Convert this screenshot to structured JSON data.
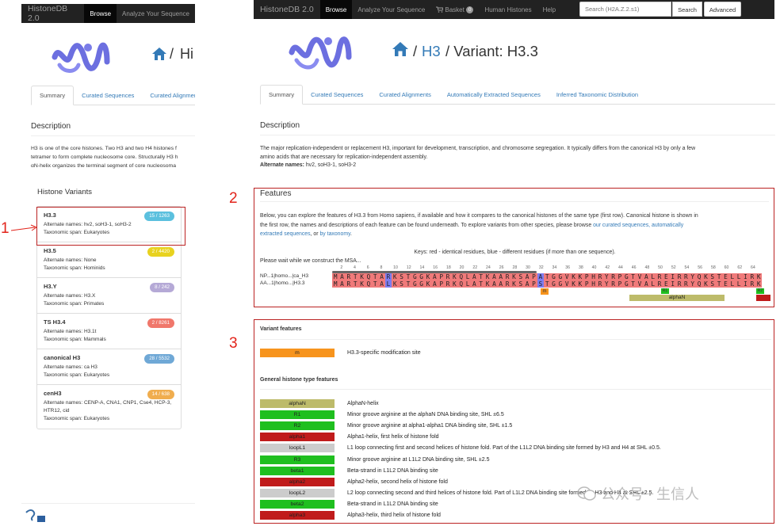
{
  "left": {
    "nav": {
      "brand": "HistoneDB 2.0",
      "browse": "Browse",
      "analyze": "Analyze Your Sequence"
    },
    "title": {
      "slash": "/",
      "text": "Hi"
    },
    "tabs": [
      "Summary",
      "Curated Sequences",
      "Curated Alignmen"
    ],
    "desc_heading": "Description",
    "desc_lines": [
      "H3 is one of the core histones. Two H3 and two H4 histones f",
      "tetramer to form complete nucleosome core. Structurally H3 h",
      "αN-helix organizes the terminal segment of core nucleosoma"
    ],
    "variants_heading": "Histone Variants",
    "variants": [
      {
        "name": "H3.3",
        "badge": "15 / 1263",
        "badge_color": "#5bc0de",
        "line1": "Alternate names: hv2, soH3-1, soH3-2",
        "line2": "Taxonomic span: Eukaryotes"
      },
      {
        "name": "H3.5",
        "badge": "2 / 4420",
        "badge_color": "#e8d21f",
        "line1": "Alternate names: None",
        "line2": "Taxonomic span: Hominids"
      },
      {
        "name": "H3.Y",
        "badge": "8 / 242",
        "badge_color": "#b5a9d6",
        "line1": "Alternate names: H3.X",
        "line2": "Taxonomic span: Primates"
      },
      {
        "name": "TS H3.4",
        "badge": "2 / 8261",
        "badge_color": "#f0776b",
        "line1": "Alternate names: H3.1t",
        "line2": "Taxonomic span: Mammals"
      },
      {
        "name": "canonical H3",
        "badge": "28 / 5532",
        "badge_color": "#6fa8d6",
        "line1": "Alternate names: ca H3",
        "line2": "Taxonomic span: Eukaryotes"
      },
      {
        "name": "cenH3",
        "badge": "14 / 638",
        "badge_color": "#f0ad4e",
        "line1": "Alternate names: CENP-A, CNA1, CNP1, Cse4, HCP-3,",
        "line1b": "HTR12, cid",
        "line2": "Taxonomic span: Eukaryotes"
      }
    ]
  },
  "annotations": {
    "a1": "1",
    "a2": "2",
    "a3": "3"
  },
  "right": {
    "nav": {
      "brand": "HistoneDB 2.0",
      "browse": "Browse",
      "analyze": "Analyze Your Sequence",
      "basket": "Basket",
      "basket_count": "0",
      "human": "Human Histones",
      "help": "Help",
      "search_placeholder": "Search (H2A.Z.2.s1)",
      "search_btn": "Search",
      "advanced_btn": "Advanced"
    },
    "title": {
      "slash1": "/",
      "h3": "H3",
      "rest": "/ Variant: H3.3"
    },
    "tabs": [
      "Summary",
      "Curated Sequences",
      "Curated Alignments",
      "Automatically Extracted Sequences",
      "Inferred Taxonomic Distribution"
    ],
    "description": {
      "heading": "Description",
      "line1": "The major replication-independent or replacement H3, important for development, transcription, and chromosome segregation. It typically differs from the canonical H3 by only a few",
      "line2": "amino acids that are necessary for replication-independent assembly.",
      "alt_label": "Alternate names:",
      "alt_value": "hv2, soH3-1, soH3-2"
    },
    "features": {
      "heading": "Features",
      "p1": "Below, you can explore the features of H3.3 from Homo sapiens, if available and how it compares to the canonical histones of the same type (first row). Canonical histone is shown in",
      "p2a": "the first row, the names and descriptions of each feature can be found underneath. To explore variants from other species, please browse ",
      "link1": "our curated sequences, automatically",
      "link2": "extracted sequences",
      "p3b": ", or ",
      "link3": "by taxonomy",
      "p3c": ".",
      "keys": "Keys: red - identical residues, blue - different residues (if more than one sequence).",
      "wait": "Please wait while we construct the MSA...",
      "ruler": [
        "2",
        "4",
        "6",
        "8",
        "10",
        "12",
        "14",
        "16",
        "18",
        "20",
        "22",
        "24",
        "26",
        "28",
        "30",
        "32",
        "34",
        "36",
        "38",
        "40",
        "42",
        "44",
        "46",
        "48",
        "50",
        "52",
        "54",
        "56",
        "58",
        "60",
        "62",
        "64"
      ],
      "seq1_label": "NP...1|homo...|ca_H3",
      "seq2_label": "AA...1|homo...|H3.3",
      "seq1": "MARTKQTARKSTGGKAPRKQLATKAARKSAPATGGVKKPHRYRPGTVALREIRRYQKSTELLIRK",
      "seq2": "MARTKQTALKSTGGKAPRKQLATKAARKSAPSTGGVKKPHRYRPGTVALREIRRYQKSTELLIRK",
      "m_label": "m",
      "r1_label": "R1",
      "r2_label": "R2",
      "alphaN_label": "alphaN"
    },
    "variant_features": {
      "heading": "Variant features",
      "items": [
        {
          "label": "m",
          "color": "#f7941d",
          "desc": "H3.3-specific modification site"
        }
      ]
    },
    "general_features": {
      "heading": "General histone type features",
      "items": [
        {
          "label": "alphaN",
          "color": "#bdbb6a",
          "desc": "AlphaN-helix"
        },
        {
          "label": "R1",
          "color": "#1fbf1f",
          "desc": "Minor groove arginine at the alphaN DNA binding site, SHL ±6.5"
        },
        {
          "label": "R2",
          "color": "#1fbf1f",
          "desc": "Minor groove arginine at alpha1-alpha1 DNA binding site, SHL ±1.5"
        },
        {
          "label": "alpha1",
          "color": "#c01b1b",
          "desc": "Alpha1-helix, first helix of histone fold"
        },
        {
          "label": "loopL1",
          "color": "#cccccc",
          "desc": "L1 loop connecting first and second helices of histone fold. Part of the L1L2 DNA binding site formed by H3 and H4 at SHL ±0.5."
        },
        {
          "label": "R3",
          "color": "#1fbf1f",
          "desc": "Minor groove arginine at L1L2 DNA binding site, SHL ±2.5"
        },
        {
          "label": "beta1",
          "color": "#1fbf1f",
          "desc": "Beta-strand in L1L2 DNA binding site"
        },
        {
          "label": "alpha2",
          "color": "#c01b1b",
          "desc": "Alpha2-helix, second helix of histone fold"
        },
        {
          "label": "loopL2",
          "color": "#cccccc",
          "desc": "L2 loop connecting second and third helices of histone fold. Part of L1L2 DNA binding site formed by H3 and H4 at SHL ±2.5."
        },
        {
          "label": "beta2",
          "color": "#1fbf1f",
          "desc": "Beta-strand in L1L2 DNA binding site"
        },
        {
          "label": "alpha3",
          "color": "#c01b1b",
          "desc": "Alpha3-helix, third helix of histone fold"
        }
      ]
    },
    "watermark": "公众号 · 生信人"
  }
}
